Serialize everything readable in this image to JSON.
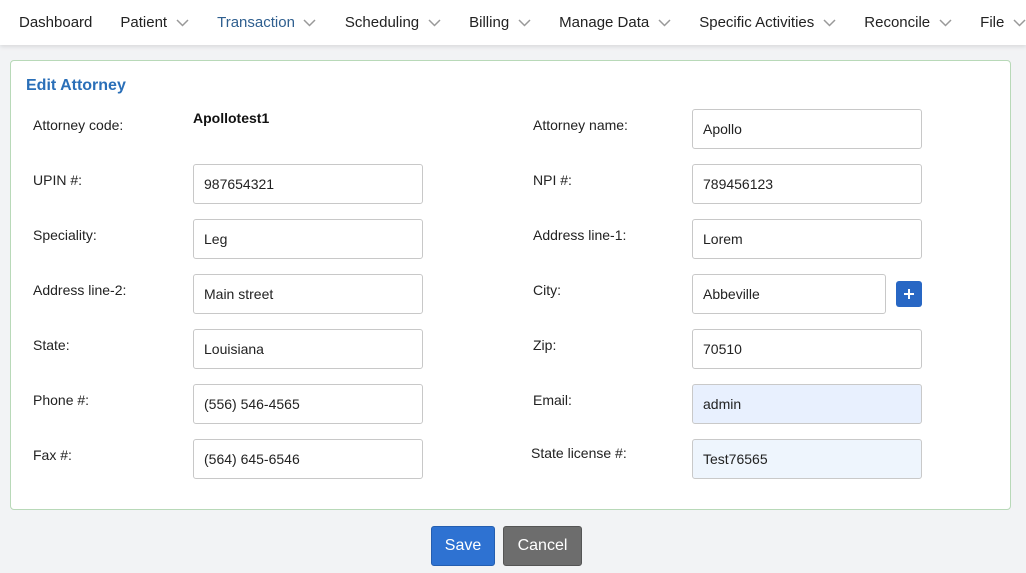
{
  "nav": {
    "items": [
      {
        "label": "Dashboard",
        "has_menu": false
      },
      {
        "label": "Patient",
        "has_menu": true
      },
      {
        "label": "Transaction",
        "has_menu": true,
        "active": true
      },
      {
        "label": "Scheduling",
        "has_menu": true
      },
      {
        "label": "Billing",
        "has_menu": true
      },
      {
        "label": "Manage Data",
        "has_menu": true
      },
      {
        "label": "Specific Activities",
        "has_menu": true
      },
      {
        "label": "Reconcile",
        "has_menu": true
      },
      {
        "label": "File",
        "has_menu": true
      }
    ],
    "active_color": "#2f5f8f"
  },
  "form": {
    "title": "Edit Attorney",
    "attorney_code_label": "Attorney code:",
    "attorney_code_value": "Apollotest1",
    "attorney_name_label": "Attorney name:",
    "attorney_name_value": "Apollo",
    "upin_label": "UPIN #:",
    "upin_value": "987654321",
    "npi_label": "NPI #:",
    "npi_value": "789456123",
    "speciality_label": "Speciality:",
    "speciality_value": "Leg",
    "address1_label": "Address line-1:",
    "address1_value": "Lorem",
    "address2_label": "Address line-2:",
    "address2_value": "Main street",
    "city_label": "City:",
    "city_value": "Abbeville",
    "state_label": "State:",
    "state_value": "Louisiana",
    "zip_label": "Zip:",
    "zip_value": "70510",
    "phone_label": "Phone #:",
    "phone_value": "(556) 546-4565",
    "email_label": "Email:",
    "email_value": "admin",
    "fax_label": "Fax #:",
    "fax_value": "(564) 645-6546",
    "state_license_label": "State license #:",
    "state_license_value": "Test76565"
  },
  "actions": {
    "save_label": "Save",
    "cancel_label": "Cancel"
  },
  "icons": {
    "add_city": "plus-icon",
    "menu_chevron": "chevron-down-icon"
  },
  "colors": {
    "title": "#2a6fb8",
    "save": "#2e72d2",
    "cancel": "#6d6d6d",
    "add_button": "#2867c4",
    "autofill_bg": "#e8f0fe"
  }
}
